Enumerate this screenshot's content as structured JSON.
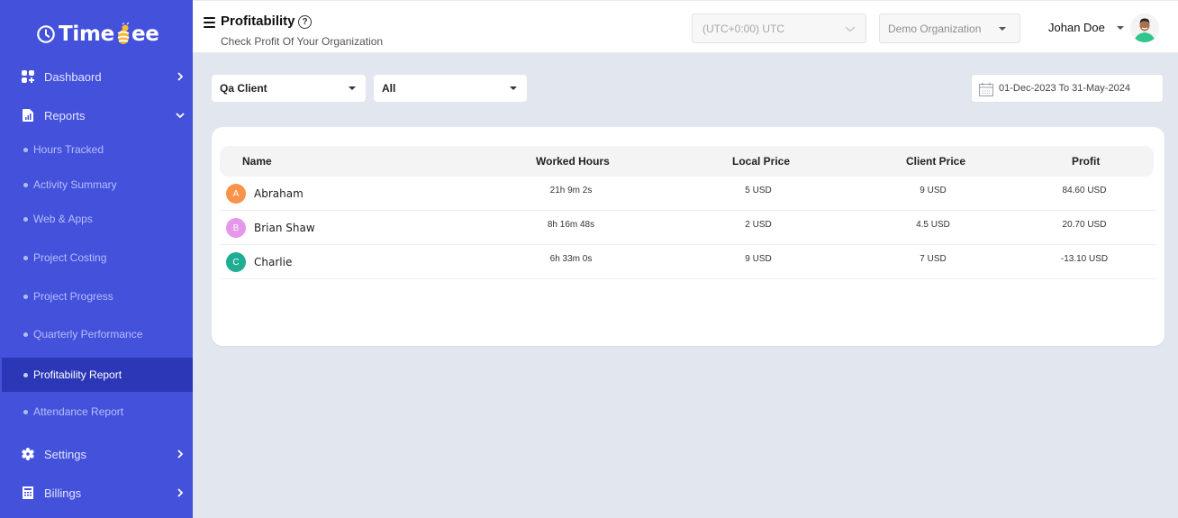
{
  "app": {
    "brand": "TimeBee",
    "colors": {
      "sidebar": "#4351db",
      "sidebar_active": "#2b37b7",
      "background": "#e2e6ef",
      "avatar_a": "#f9934a",
      "avatar_b": "#e597ea",
      "avatar_c": "#1fad93"
    }
  },
  "sidebar": {
    "items": [
      {
        "label": "Dashbaord",
        "icon": "dashboard-icon",
        "chevron": "right"
      },
      {
        "label": "Reports",
        "icon": "report-icon",
        "chevron": "down"
      }
    ],
    "sub_items": [
      {
        "label": "Hours Tracked"
      },
      {
        "label": "Activity Summary"
      },
      {
        "label": "Web & Apps"
      },
      {
        "label": "Project Costing"
      },
      {
        "label": "Project Progress"
      },
      {
        "label": "Quarterly Performance"
      },
      {
        "label": "Profitability Report",
        "active": true
      },
      {
        "label": "Attendance Report"
      }
    ],
    "bottom_items": [
      {
        "label": "Settings",
        "icon": "gear-icon",
        "chevron": "right"
      },
      {
        "label": "Billings",
        "icon": "billing-icon",
        "chevron": "right"
      }
    ]
  },
  "header": {
    "title": "Profitability",
    "subtitle": "Check Profit Of Your Organization",
    "timezone": "(UTC+0:00) UTC",
    "organization": "Demo Organization",
    "user_name": "Johan Doe"
  },
  "filters": {
    "client": "Qa Client",
    "scope": "All",
    "date_range": "01-Dec-2023 To 31-May-2024"
  },
  "table": {
    "columns": [
      "Name",
      "Worked Hours",
      "Local Price",
      "Client Price",
      "Profit"
    ],
    "rows": [
      {
        "initial": "A",
        "name": "Abraham",
        "worked_hours": "21h 9m 2s",
        "local_price": "5 USD",
        "client_price": "9 USD",
        "profit": "84.60 USD"
      },
      {
        "initial": "B",
        "name": "Brian Shaw",
        "worked_hours": "8h 16m 48s",
        "local_price": "2 USD",
        "client_price": "4.5 USD",
        "profit": "20.70 USD"
      },
      {
        "initial": "C",
        "name": "Charlie",
        "worked_hours": "6h 33m 0s",
        "local_price": "9 USD",
        "client_price": "7 USD",
        "profit": "-13.10 USD"
      }
    ]
  }
}
